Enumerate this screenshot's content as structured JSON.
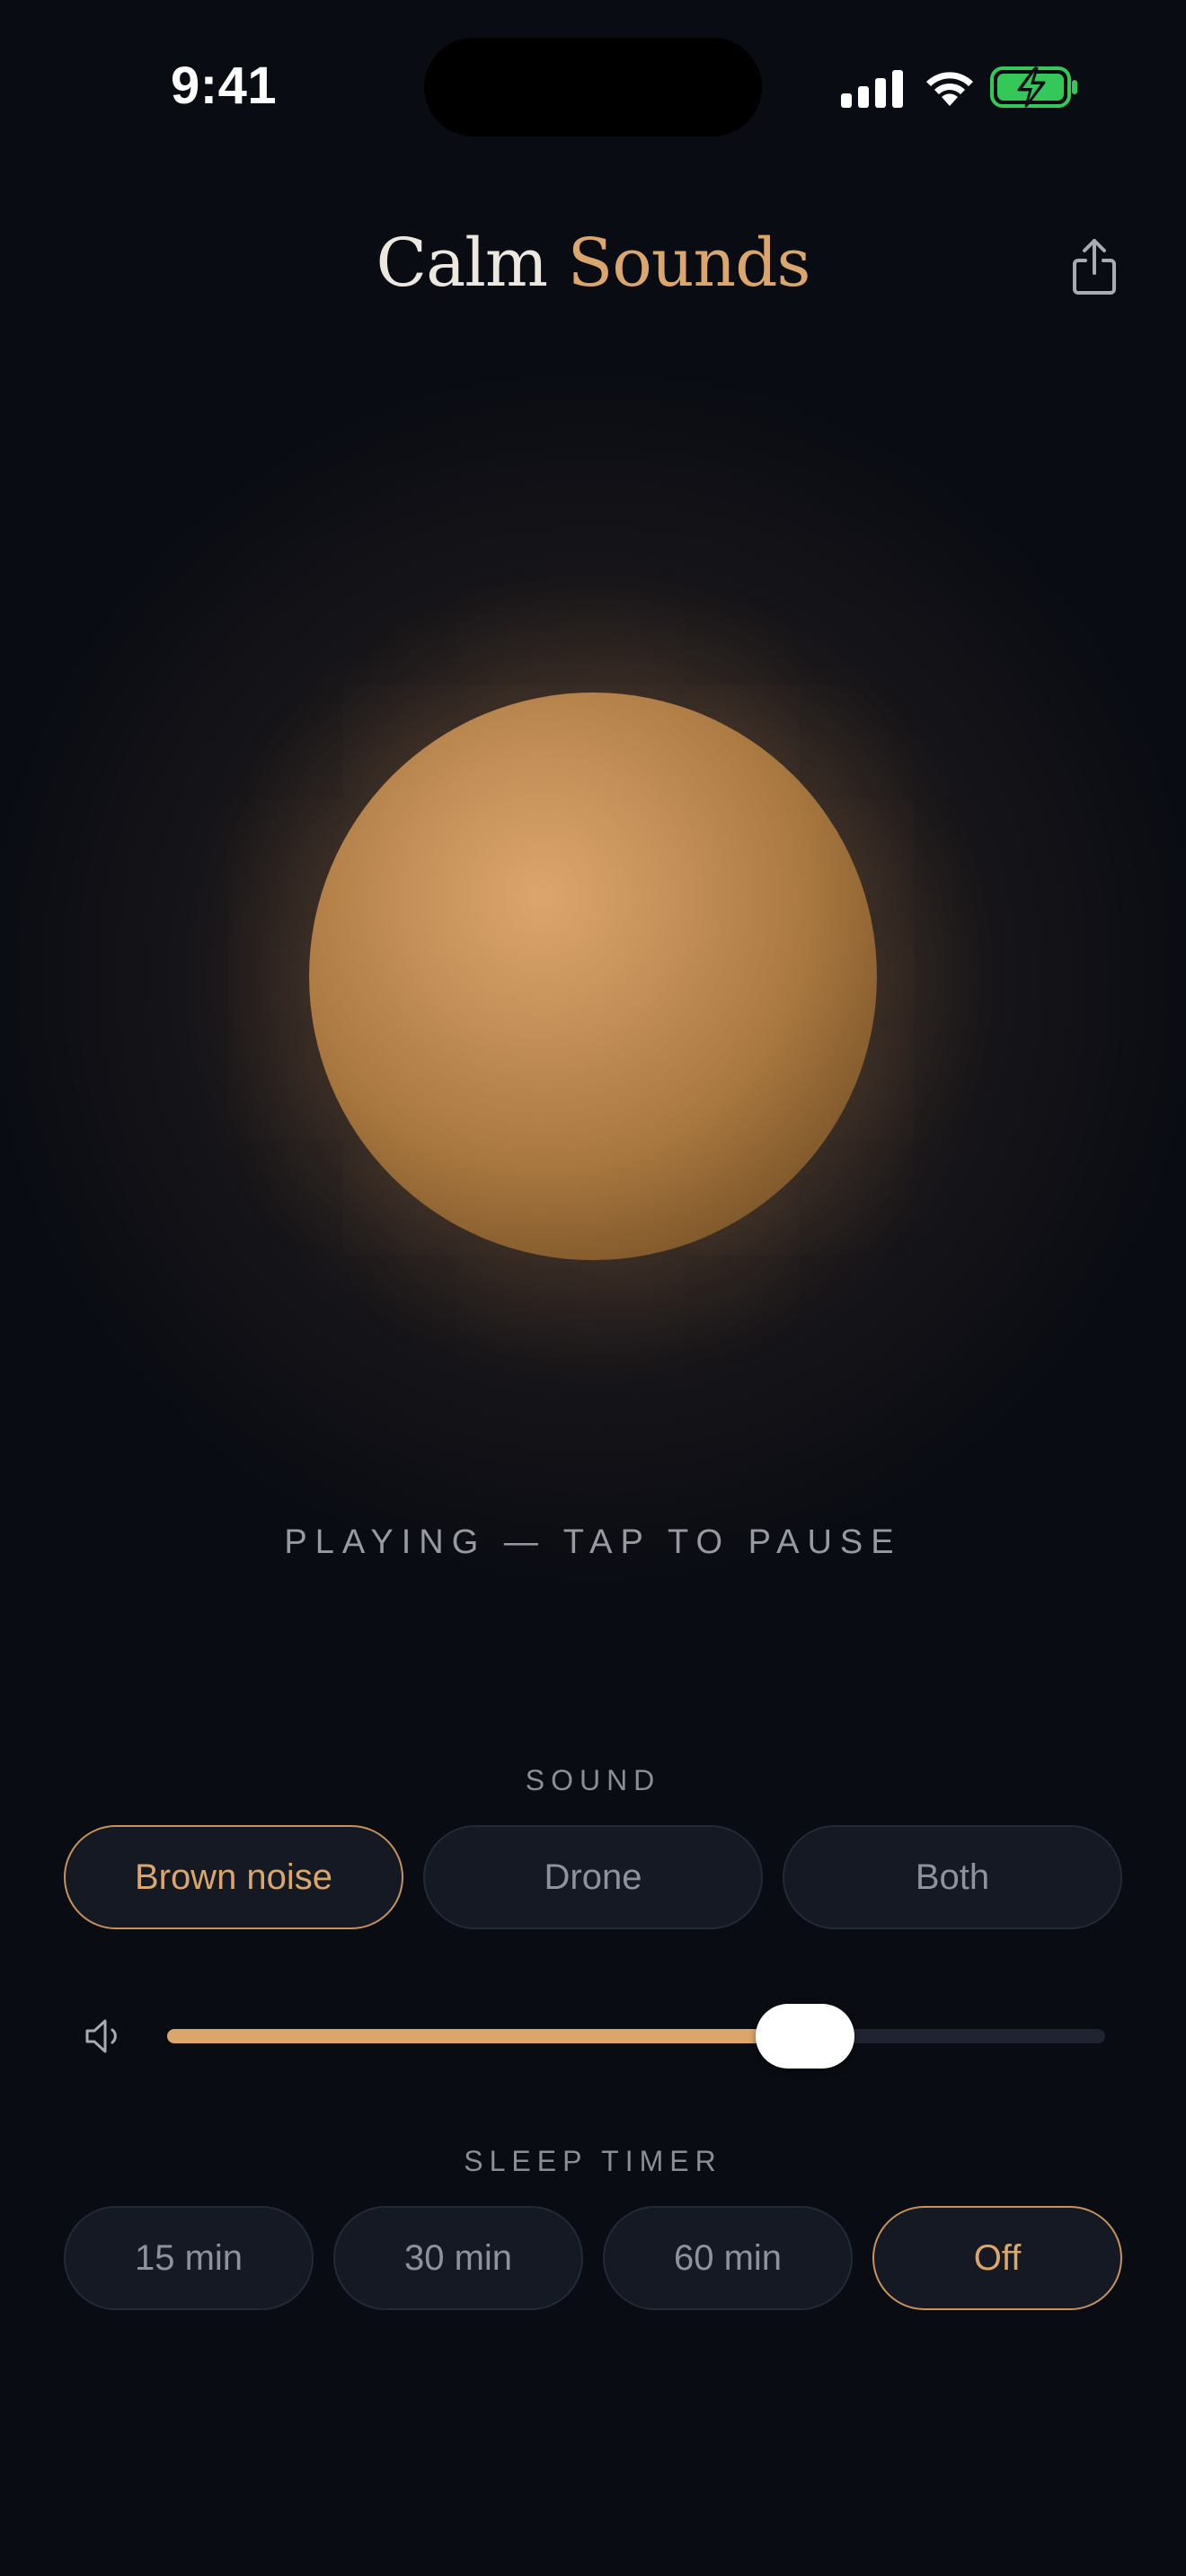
{
  "status_bar": {
    "time": "9:41",
    "battery_color": "#34c759"
  },
  "header": {
    "title_part1": "Calm",
    "title_part2": "Sounds",
    "accent_color": "#dba66c",
    "share_icon": "share-icon"
  },
  "player": {
    "status": "PLAYING — TAP TO PAUSE",
    "orb_color": "#c48f58"
  },
  "sound": {
    "label": "SOUND",
    "options": [
      "Brown noise",
      "Drone",
      "Both"
    ],
    "selected": "Brown noise"
  },
  "volume": {
    "icon": "speaker-icon",
    "level": 0.68
  },
  "sleep_timer": {
    "label": "SLEEP TIMER",
    "options": [
      "15 min",
      "30 min",
      "60 min",
      "Off"
    ],
    "selected": "Off"
  }
}
